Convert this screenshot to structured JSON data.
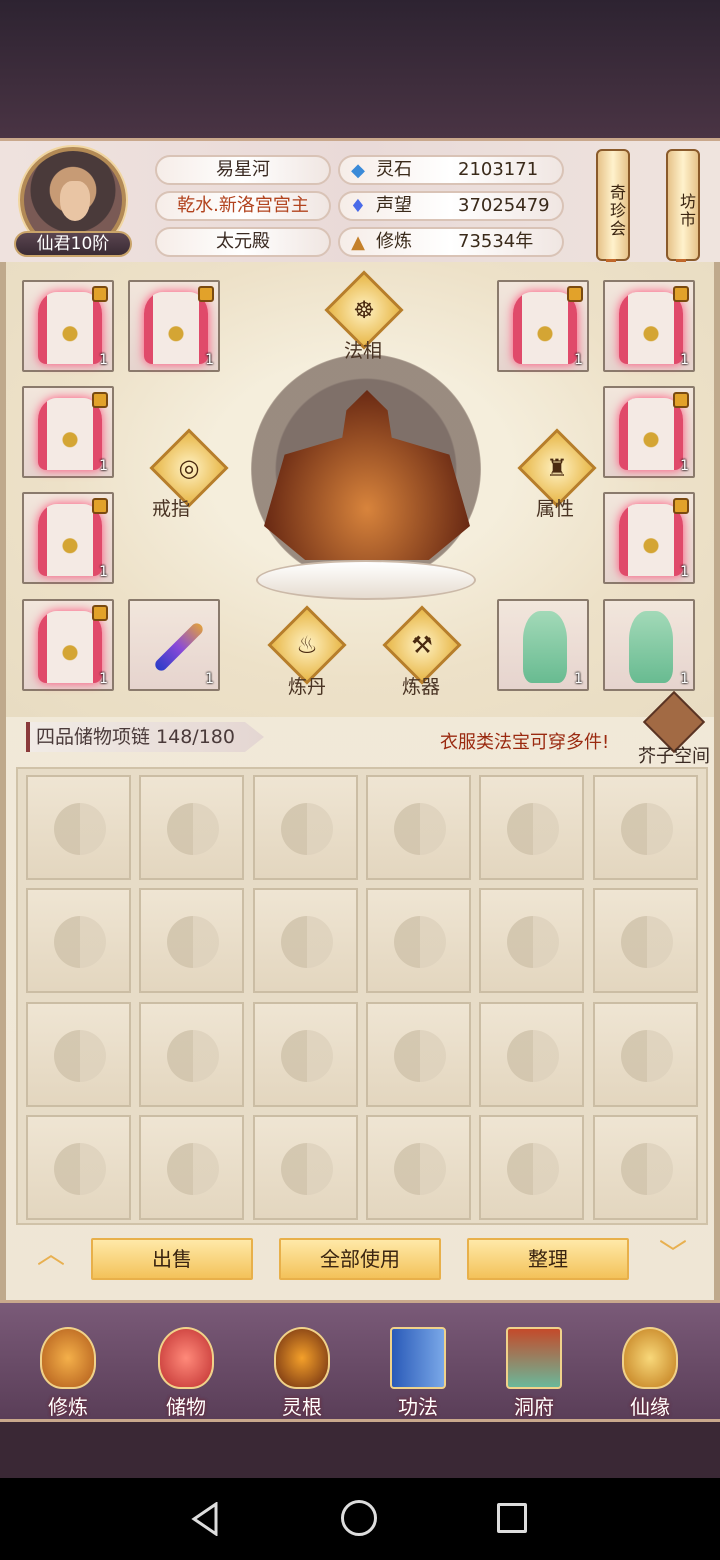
{
  "player": {
    "rank": "仙君10阶",
    "name": "易星河",
    "title": "乾水.新洛宫宫主",
    "sect": "太元殿"
  },
  "stats": [
    {
      "icon": "spirit-stone-icon",
      "label": "灵石",
      "value": "2103171"
    },
    {
      "icon": "reputation-icon",
      "label": "声望",
      "value": "37025479"
    },
    {
      "icon": "cultivation-icon",
      "label": "修炼",
      "value": "73534年"
    }
  ],
  "side_buttons": {
    "rare_treasure": "奇珍会",
    "market": "坊市"
  },
  "equipment": {
    "dharma_label": "法相",
    "ring_label": "戒指",
    "attribute_label": "属性",
    "alchemy_label": "炼丹",
    "forge_label": "炼器",
    "slot_qty": "1"
  },
  "bag": {
    "label": "四品储物项链 148/180",
    "tip": "衣服类法宝可穿多件!",
    "mustard_label": "芥子空间"
  },
  "actions": {
    "sell": "出售",
    "use_all": "全部使用",
    "sort": "整理"
  },
  "nav": [
    {
      "label": "修炼",
      "icon": "meditation-icon"
    },
    {
      "label": "储物",
      "icon": "bag-icon"
    },
    {
      "label": "灵根",
      "icon": "spirit-root-icon"
    },
    {
      "label": "功法",
      "icon": "book-icon"
    },
    {
      "label": "洞府",
      "icon": "cave-house-icon"
    },
    {
      "label": "仙缘",
      "icon": "gourd-icon"
    }
  ]
}
